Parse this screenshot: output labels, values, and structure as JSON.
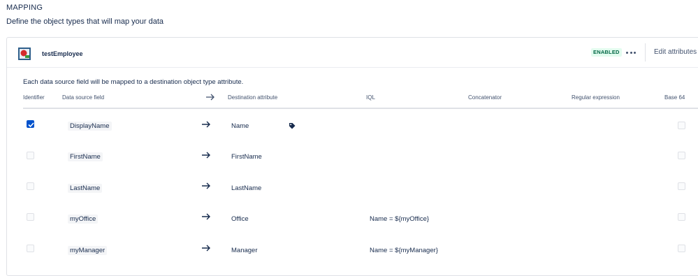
{
  "section": {
    "title": "MAPPING",
    "description": "Define the object types that will map your data"
  },
  "object_type": {
    "name": "testEmployee",
    "status": "ENABLED",
    "edit_label": "Edit attributes",
    "icon": "employee-badge-icon"
  },
  "mapping": {
    "note": "Each data source field will be mapped to a destination object type attribute.",
    "columns": {
      "identifier": "Identifier",
      "source": "Data source field",
      "destination": "Destination attribute",
      "iql": "IQL",
      "concatenator": "Concatenator",
      "regex": "Regular expression",
      "base64": "Base 64"
    },
    "rows": [
      {
        "identifier": true,
        "source": "DisplayName",
        "destination": "Name",
        "label_attribute": true,
        "iql": "",
        "base64": false
      },
      {
        "identifier": false,
        "source": "FirstName",
        "destination": "FirstName",
        "label_attribute": false,
        "iql": "",
        "base64": false
      },
      {
        "identifier": false,
        "source": "LastName",
        "destination": "LastName",
        "label_attribute": false,
        "iql": "",
        "base64": false
      },
      {
        "identifier": false,
        "source": "myOffice",
        "destination": "Office",
        "label_attribute": false,
        "iql": "Name = ${myOffice}",
        "base64": false
      },
      {
        "identifier": false,
        "source": "myManager",
        "destination": "Manager",
        "label_attribute": false,
        "iql": "Name = ${myManager}",
        "base64": false
      }
    ]
  },
  "colors": {
    "accent": "#0052cc",
    "status_green": "#006644",
    "status_bg": "#e3fcef",
    "text": "#172b4d"
  }
}
